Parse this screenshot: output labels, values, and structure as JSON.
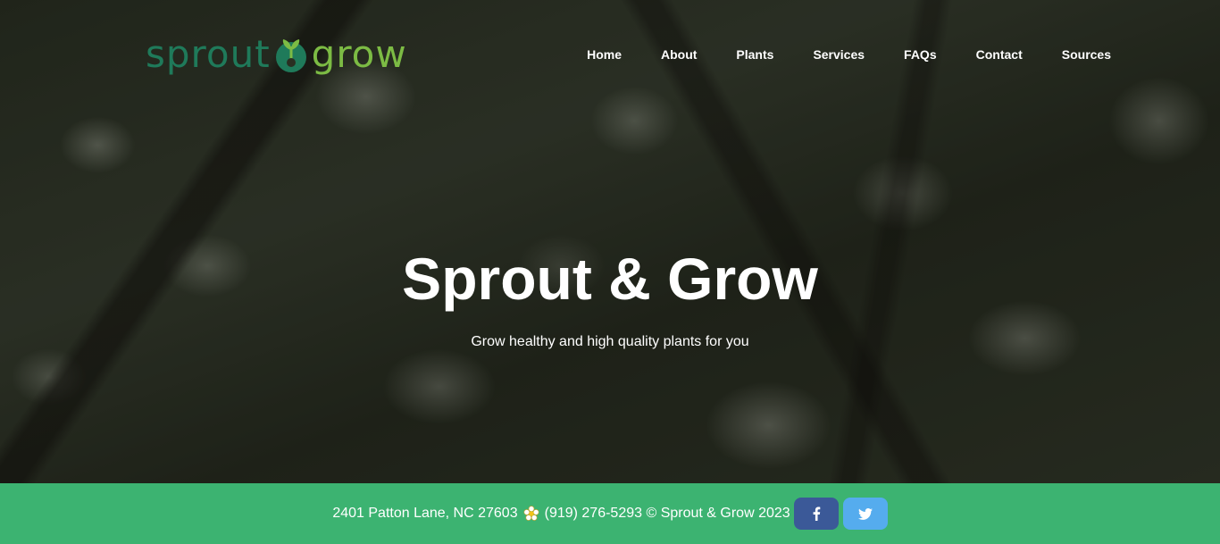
{
  "brand": {
    "logo_text_left": "sprout",
    "logo_text_right": "grow",
    "colors": {
      "dark_green": "#1f7a5a",
      "light_green": "#7cbb44"
    }
  },
  "nav": {
    "items": [
      {
        "label": "Home"
      },
      {
        "label": "About"
      },
      {
        "label": "Plants"
      },
      {
        "label": "Services"
      },
      {
        "label": "FAQs"
      },
      {
        "label": "Contact"
      },
      {
        "label": "Sources"
      }
    ]
  },
  "hero": {
    "title": "Sprout & Grow",
    "subtitle": "Grow healthy and high quality plants for you"
  },
  "footer": {
    "address": "2401 Patton Lane, NC 27603",
    "separator_icon": "flower-icon",
    "contact": "(919) 276-5293 © Sprout & Grow 2023",
    "background": "#3cb371",
    "social": [
      {
        "name": "facebook",
        "icon": "facebook-icon",
        "color": "#3b5998"
      },
      {
        "name": "twitter",
        "icon": "twitter-icon",
        "color": "#55acee"
      }
    ]
  }
}
